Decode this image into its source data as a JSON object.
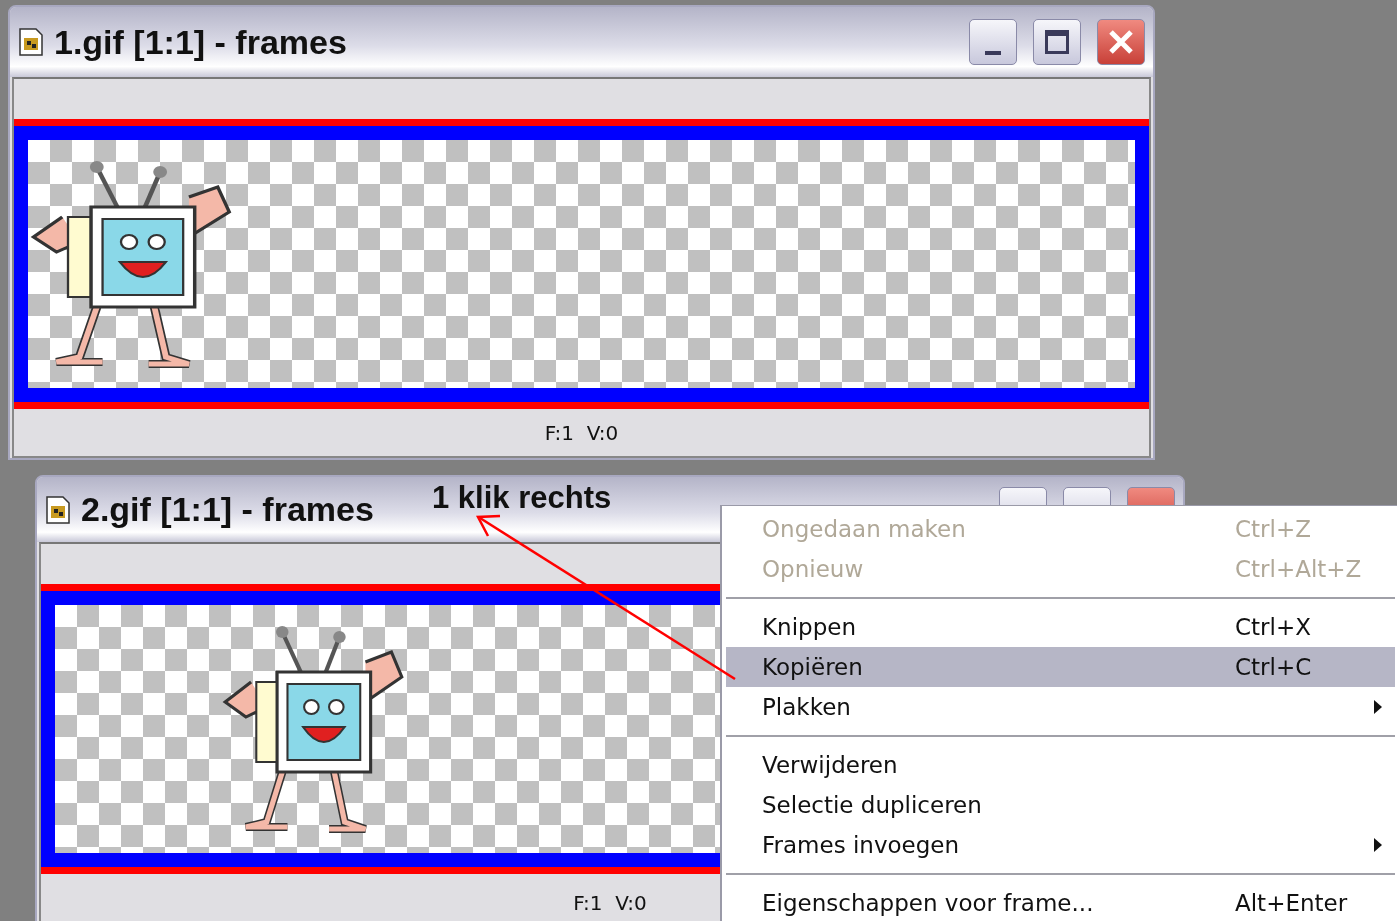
{
  "windows": [
    {
      "title": "1.gif [1:1] - frames",
      "status": "F:1  V:0"
    },
    {
      "title": "2.gif [1:1] - frames",
      "status": "F:1  V:0"
    }
  ],
  "annotation": {
    "text": "1 klik rechts"
  },
  "context_menu": {
    "groups": [
      [
        {
          "label": "Ongedaan maken",
          "shortcut": "Ctrl+Z",
          "disabled": true,
          "selected": false,
          "submenu": false
        },
        {
          "label": "Opnieuw",
          "shortcut": "Ctrl+Alt+Z",
          "disabled": true,
          "selected": false,
          "submenu": false
        }
      ],
      [
        {
          "label": "Knippen",
          "shortcut": "Ctrl+X",
          "disabled": false,
          "selected": false,
          "submenu": false
        },
        {
          "label": "Kopiëren",
          "shortcut": "Ctrl+C",
          "disabled": false,
          "selected": true,
          "submenu": false
        },
        {
          "label": "Plakken",
          "disabled": false,
          "selected": false,
          "submenu": true
        }
      ],
      [
        {
          "label": "Verwijderen",
          "disabled": false,
          "selected": false,
          "submenu": false
        },
        {
          "label": "Selectie dupliceren",
          "disabled": false,
          "selected": false,
          "submenu": false
        },
        {
          "label": "Frames invoegen",
          "disabled": false,
          "selected": false,
          "submenu": true
        }
      ],
      [
        {
          "label": "Eigenschappen voor frame...",
          "shortcut": "Alt+Enter",
          "disabled": false,
          "selected": false,
          "submenu": false
        }
      ]
    ]
  }
}
